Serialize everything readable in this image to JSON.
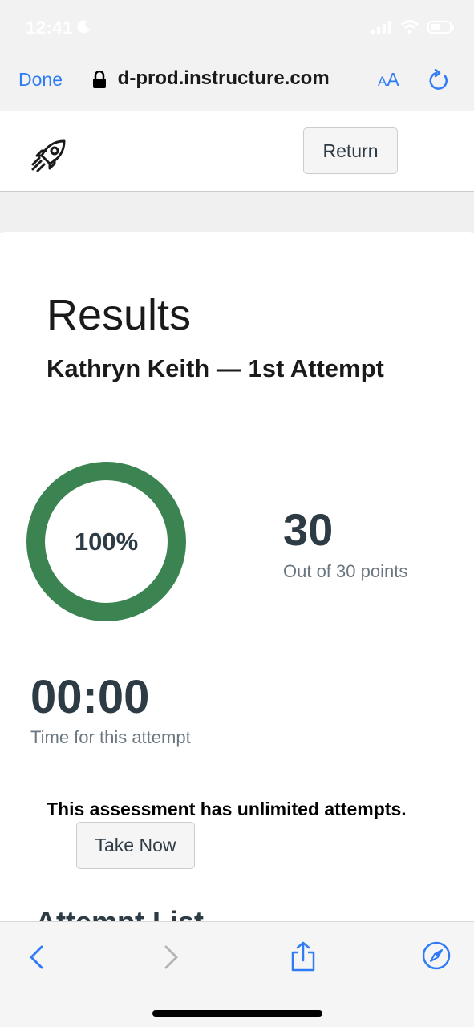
{
  "status": {
    "time": "12:41"
  },
  "browser": {
    "done_label": "Done",
    "url": " d-prod.instructure.com",
    "aa_small": "A",
    "aa_big": "A"
  },
  "header": {
    "return_label": "Return"
  },
  "results": {
    "title": "Results",
    "subtitle": "Kathryn Keith — 1st Attempt",
    "percent_label": "100%",
    "percent_value": 1.0,
    "score": "30",
    "score_caption": "Out of 30 points",
    "time": "00:00",
    "time_caption": "Time for this attempt",
    "unlimited_notice": "This assessment has unlimited attempts.",
    "take_now_label": "Take Now",
    "attempt_list_heading": "Attempt List"
  },
  "colors": {
    "accent_blue": "#2f7cf6",
    "donut_green": "#3b8451",
    "text_dark": "#2d3b45",
    "text_muted": "#6b7780"
  }
}
